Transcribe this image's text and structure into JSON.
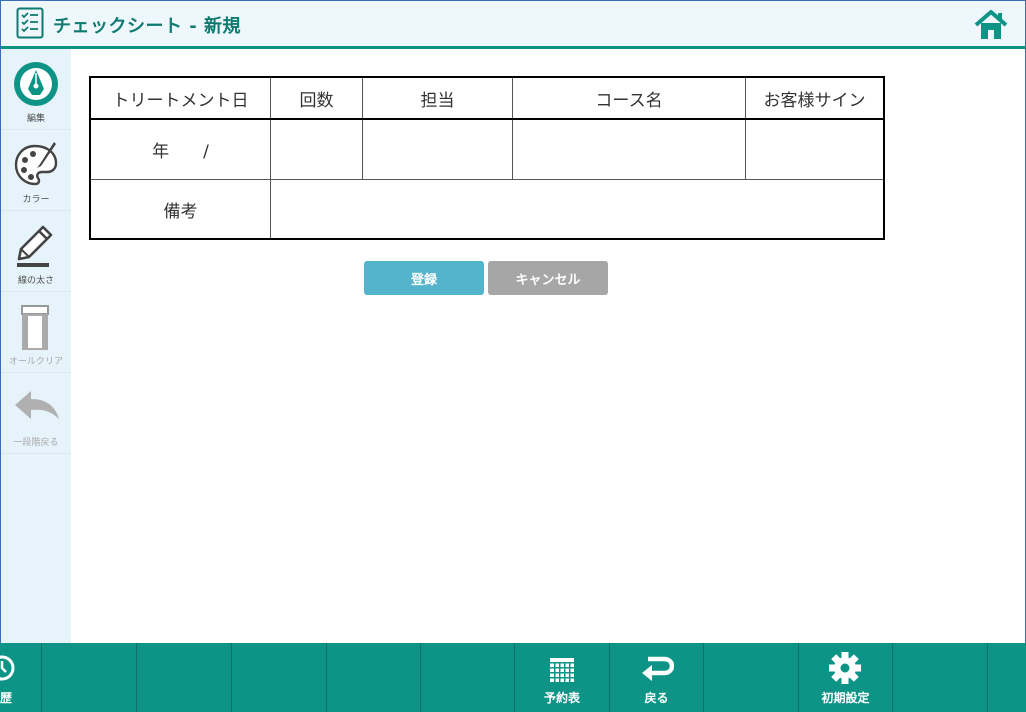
{
  "header": {
    "title": "チェックシート - 新規",
    "icons": {
      "app": "checklist-icon",
      "home": "home-icon"
    },
    "accent": "#0e9486"
  },
  "sidebar": {
    "items": [
      {
        "label": "編集",
        "icon": "pen-nib-icon",
        "enabled": true
      },
      {
        "label": "カラー",
        "icon": "palette-icon",
        "enabled": true
      },
      {
        "label": "線の太さ",
        "icon": "pencil-line-icon",
        "enabled": true
      },
      {
        "label": "オールクリア",
        "icon": "eraser-icon",
        "enabled": false
      },
      {
        "label": "一段階戻る",
        "icon": "undo-arrow-icon",
        "enabled": false
      }
    ]
  },
  "table": {
    "headers": [
      "トリートメント日",
      "回数",
      "担当",
      "コース名",
      "お客様サイン"
    ],
    "date_cell": "年　　/",
    "remarks_label": "備考"
  },
  "actions": {
    "register": "登録",
    "cancel": "キャンセル"
  },
  "footer": {
    "items": [
      {
        "label": "履歴",
        "icon": "history-icon"
      },
      {
        "label": "",
        "icon": ""
      },
      {
        "label": "",
        "icon": ""
      },
      {
        "label": "",
        "icon": ""
      },
      {
        "label": "",
        "icon": ""
      },
      {
        "label": "予約表",
        "icon": "calendar-grid-icon"
      },
      {
        "label": "戻る",
        "icon": "return-arrow-icon"
      },
      {
        "label": "",
        "icon": ""
      },
      {
        "label": "初期設定",
        "icon": "gear-icon"
      },
      {
        "label": "",
        "icon": ""
      }
    ]
  }
}
